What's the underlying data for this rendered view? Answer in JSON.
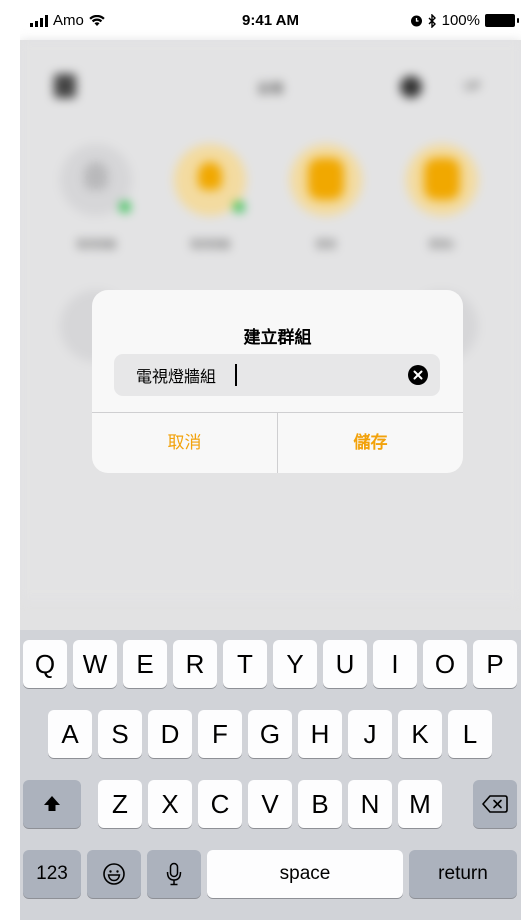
{
  "status_bar": {
    "carrier": "Amo",
    "time": "9:41 AM",
    "battery": "100%"
  },
  "background": {
    "title": "設備",
    "edit": "UP",
    "devices": [
      {
        "label": "電視燈牆"
      },
      {
        "label": "電視燈牆"
      },
      {
        "label": "壁燈"
      },
      {
        "label": "壁燈2"
      }
    ]
  },
  "dialog": {
    "title": "建立群組",
    "input_value": "電視燈牆組",
    "cancel_label": "取消",
    "save_label": "儲存"
  },
  "keyboard": {
    "row1": [
      "Q",
      "W",
      "E",
      "R",
      "T",
      "Y",
      "U",
      "I",
      "O",
      "P"
    ],
    "row2": [
      "A",
      "S",
      "D",
      "F",
      "G",
      "H",
      "J",
      "K",
      "L"
    ],
    "row3": [
      "Z",
      "X",
      "C",
      "V",
      "B",
      "N",
      "M"
    ],
    "numbers_label": "123",
    "space_label": "space",
    "return_label": "return"
  },
  "colors": {
    "accent": "#f2a20b",
    "keyboard_bg": "#d1d3d8",
    "dialog_bg": "#f8f8f8"
  }
}
